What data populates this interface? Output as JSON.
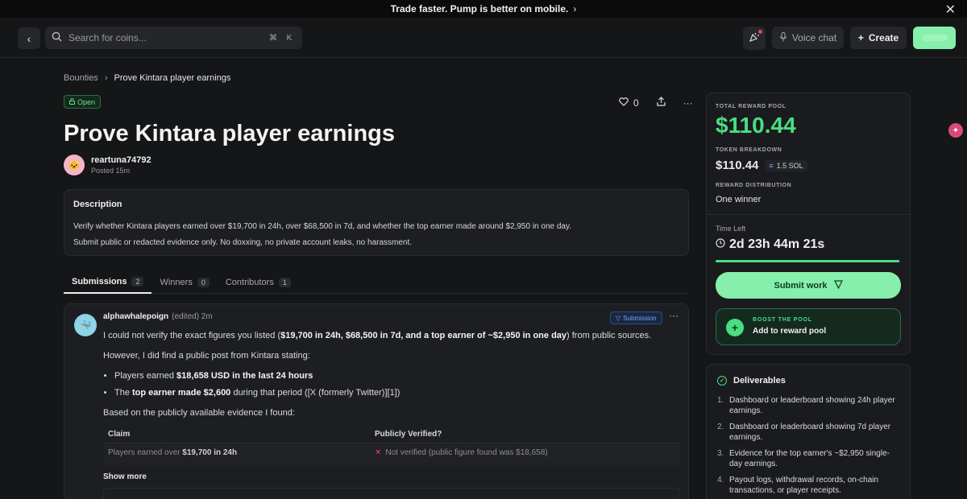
{
  "banner": {
    "text": "Trade faster. Pump is better on mobile."
  },
  "topbar": {
    "search_placeholder": "Search for coins...",
    "kbd": [
      "⌘",
      "K"
    ],
    "voice_chat": "Voice chat",
    "create": "Create"
  },
  "breadcrumb": {
    "root": "Bounties",
    "current": "Prove Kintara player earnings"
  },
  "bounty": {
    "status": "Open",
    "title": "Prove Kintara player earnings",
    "likes": "0",
    "author": "reartuna74792",
    "posted": "Posted 15m"
  },
  "description": {
    "heading": "Description",
    "lines": [
      "Verify whether Kintara players earned over $19,700 in 24h, over $68,500 in 7d, and whether the top earner made around $2,950 in one day.",
      "Submit public or redacted evidence only. No doxxing, no private account leaks, no harassment."
    ]
  },
  "tabs": [
    {
      "label": "Submissions",
      "count": "2"
    },
    {
      "label": "Winners",
      "count": "0"
    },
    {
      "label": "Contributors",
      "count": "1"
    }
  ],
  "submission": {
    "user": "alphawhalepoign",
    "meta": "(edited) 2m",
    "badge": "Submission",
    "p1_a": "I could not verify the exact figures you listed (",
    "p1_b": "$19,700 in 24h, $68,500 in 7d, and a top earner of ~$2,950 in one day",
    "p1_c": ") from public sources.",
    "p2": "However, I did find a public post from Kintara stating:",
    "b1_a": "Players earned ",
    "b1_b": "$18,658 USD in the last 24 hours",
    "b2_a": "The ",
    "b2_b": "top earner made $2,600",
    "b2_c": " during that period ([X (formerly Twitter)][1])",
    "p3": "Based on the publicly available evidence I found:",
    "table": {
      "h1": "Claim",
      "h2": "Publicly Verified?",
      "r1_a": "Players earned over ",
      "r1_b": "$19,700 in 24h",
      "r1_c": "Not verified (public figure found was $18,658)"
    },
    "show_more": "Show more"
  },
  "sidebar": {
    "pool_label": "TOTAL REWARD POOL",
    "pool_value": "$110.44",
    "token_label": "TOKEN BREAKDOWN",
    "token_usd": "$110.44",
    "token_sol": "1.5 SOL",
    "dist_label": "REWARD DISTRIBUTION",
    "dist_value": "One winner",
    "time_label": "Time Left",
    "time_value": "2d 23h 44m 21s",
    "time_progress": 0.99,
    "submit": "Submit work",
    "boost_label": "BOOST THE POOL",
    "boost_action": "Add to reward pool"
  },
  "deliverables": {
    "title": "Deliverables",
    "items": [
      "Dashboard or leaderboard showing 24h player earnings.",
      "Dashboard or leaderboard showing 7d player earnings.",
      "Evidence for the top earner's ~$2,950 single-day earnings.",
      "Payout logs, withdrawal records, on-chain transactions, or player receipts."
    ]
  },
  "colors": {
    "accent_green": "#4ade80",
    "button_green": "#86efac",
    "bg": "#151618"
  }
}
